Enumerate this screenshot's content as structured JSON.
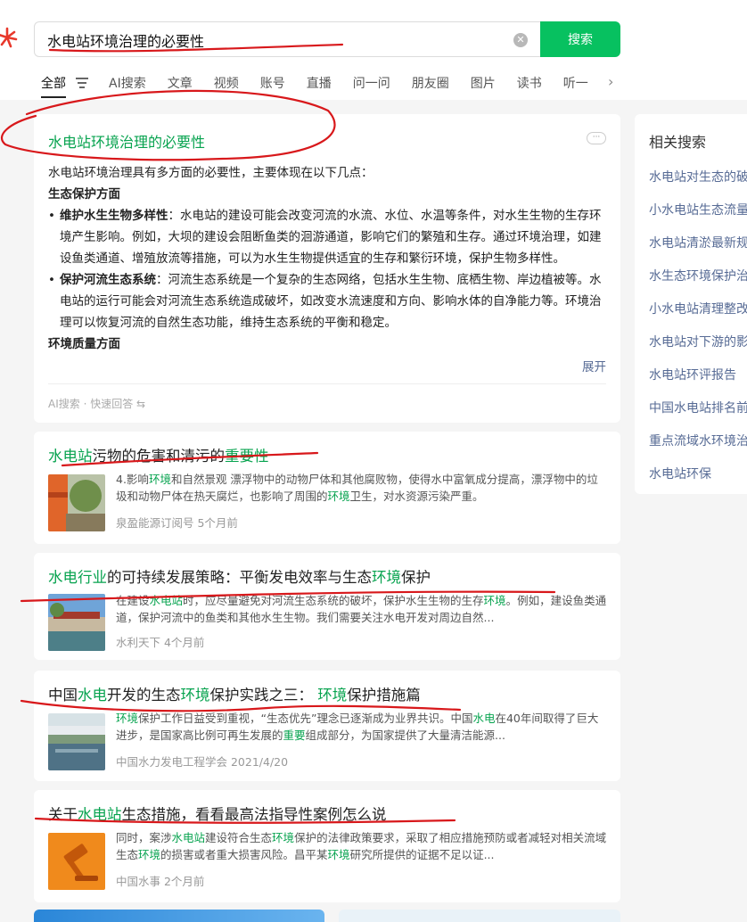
{
  "search": {
    "query": "水电站环境治理的必要性",
    "button_label": "搜索"
  },
  "tabs": [
    "全部",
    "AI搜索",
    "文章",
    "视频",
    "账号",
    "直播",
    "问一问",
    "朋友圈",
    "图片",
    "读书",
    "听一"
  ],
  "ai_card": {
    "title": "水电站环境治理的必要性",
    "intro": "水电站环境治理具有多方面的必要性，主要体现在以下几点：",
    "section1": "生态保护方面",
    "bullet1_head": "维护水生生物多样性",
    "bullet1_text": "：水电站的建设可能会改变河流的水流、水位、水温等条件，对水生生物的生存环境产生影响。例如，大坝的建设会阻断鱼类的洄游通道，影响它们的繁殖和生存。通过环境治理，如建设鱼类通道、增殖放流等措施，可以为水生生物提供适宜的生存和繁衍环境，保护生物多样性。",
    "bullet2_head": "保护河流生态系统",
    "bullet2_text": "：河流生态系统是一个复杂的生态网络，包括水生生物、底栖生物、岸边植被等。水电站的运行可能会对河流生态系统造成破坏，如改变水流速度和方向、影响水体的自净能力等。环境治理可以恢复河流的自然生态功能，维持生态系统的平衡和稳定。",
    "section2": "环境质量方面",
    "expand_label": "展开",
    "footer": "AI搜索 · 快速回答 ⇆"
  },
  "results": [
    {
      "title_parts": [
        {
          "text": "水电站",
          "hl": true
        },
        {
          "text": "污物的危害和清污的",
          "hl": false
        },
        {
          "text": "重要性",
          "hl": true
        }
      ],
      "snippet_parts": [
        {
          "text": "4.影响",
          "hl": false
        },
        {
          "text": "环境",
          "hl": true
        },
        {
          "text": "和自然景观 漂浮物中的动物尸体和其他腐败物，使得水中富氧成分提高，漂浮物中的垃圾和动物尸体在热天腐烂，也影响了周围的",
          "hl": false
        },
        {
          "text": "环境",
          "hl": true
        },
        {
          "text": "卫生，对水资源污染严重。",
          "hl": false
        }
      ],
      "source": "泉盈能源订阅号  5个月前"
    },
    {
      "title_parts": [
        {
          "text": "水电行业",
          "hl": true
        },
        {
          "text": "的可持续发展策略：平衡发电效率与生态",
          "hl": false
        },
        {
          "text": "环境",
          "hl": true
        },
        {
          "text": "保护",
          "hl": false
        }
      ],
      "snippet_parts": [
        {
          "text": "在建设",
          "hl": false
        },
        {
          "text": "水电站",
          "hl": true
        },
        {
          "text": "时，应尽量避免对河流生态系统的破坏，保护水生生物的生存",
          "hl": false
        },
        {
          "text": "环境",
          "hl": true
        },
        {
          "text": "。例如，建设鱼类通道，保护河流中的鱼类和其他水生生物。我们需要关注水电开发对周边自然...",
          "hl": false
        }
      ],
      "source": "水利天下  4个月前"
    },
    {
      "title_parts": [
        {
          "text": "中国",
          "hl": false
        },
        {
          "text": "水电",
          "hl": true
        },
        {
          "text": "开发的生态",
          "hl": false
        },
        {
          "text": "环境",
          "hl": true
        },
        {
          "text": "保护实践之三： ",
          "hl": false
        },
        {
          "text": "环境",
          "hl": true
        },
        {
          "text": "保护措施篇",
          "hl": false
        }
      ],
      "snippet_parts": [
        {
          "text": "环境",
          "hl": true
        },
        {
          "text": "保护工作日益受到重视，“生态优先”理念已逐渐成为业界共识。中国",
          "hl": false
        },
        {
          "text": "水电",
          "hl": true
        },
        {
          "text": "在40年间取得了巨大进步，是国家高比例可再生发展的",
          "hl": false
        },
        {
          "text": "重要",
          "hl": true
        },
        {
          "text": "组成部分，为国家提供了大量清洁能源...",
          "hl": false
        }
      ],
      "source": "中国水力发电工程学会  2021/4/20"
    },
    {
      "title_parts": [
        {
          "text": "关于",
          "hl": false
        },
        {
          "text": "水电站",
          "hl": true
        },
        {
          "text": "生态措施，看看最高法指导性案例怎么说",
          "hl": false
        }
      ],
      "snippet_parts": [
        {
          "text": "同时，案涉",
          "hl": false
        },
        {
          "text": "水电站",
          "hl": true
        },
        {
          "text": "建设符合生态",
          "hl": false
        },
        {
          "text": "环境",
          "hl": true
        },
        {
          "text": "保护的法律政策要求，采取了相应措施预防或者减轻对相关流域生态",
          "hl": false
        },
        {
          "text": "环境",
          "hl": true
        },
        {
          "text": "的损害或者重大损害风险。昌平某",
          "hl": false
        },
        {
          "text": "环境",
          "hl": true
        },
        {
          "text": "研究所提供的证据不足以证...",
          "hl": false
        }
      ],
      "source": "中国水事  2个月前"
    }
  ],
  "related": {
    "title": "相关搜索",
    "items": [
      "水电站对生态的破坏",
      "小水电站生态流量",
      "水电站清淤最新规定",
      "水生态环境保护治理",
      "小水电站清理整改",
      "水电站对下游的影响",
      "水电站环评报告",
      "中国水电站排名前十",
      "重点流域水环境治理",
      "水电站环保"
    ]
  },
  "colors": {
    "accent_green": "#07c160",
    "highlight_green": "#07a34f",
    "link_blue": "#576b95",
    "annotation_red": "#d8181b"
  }
}
